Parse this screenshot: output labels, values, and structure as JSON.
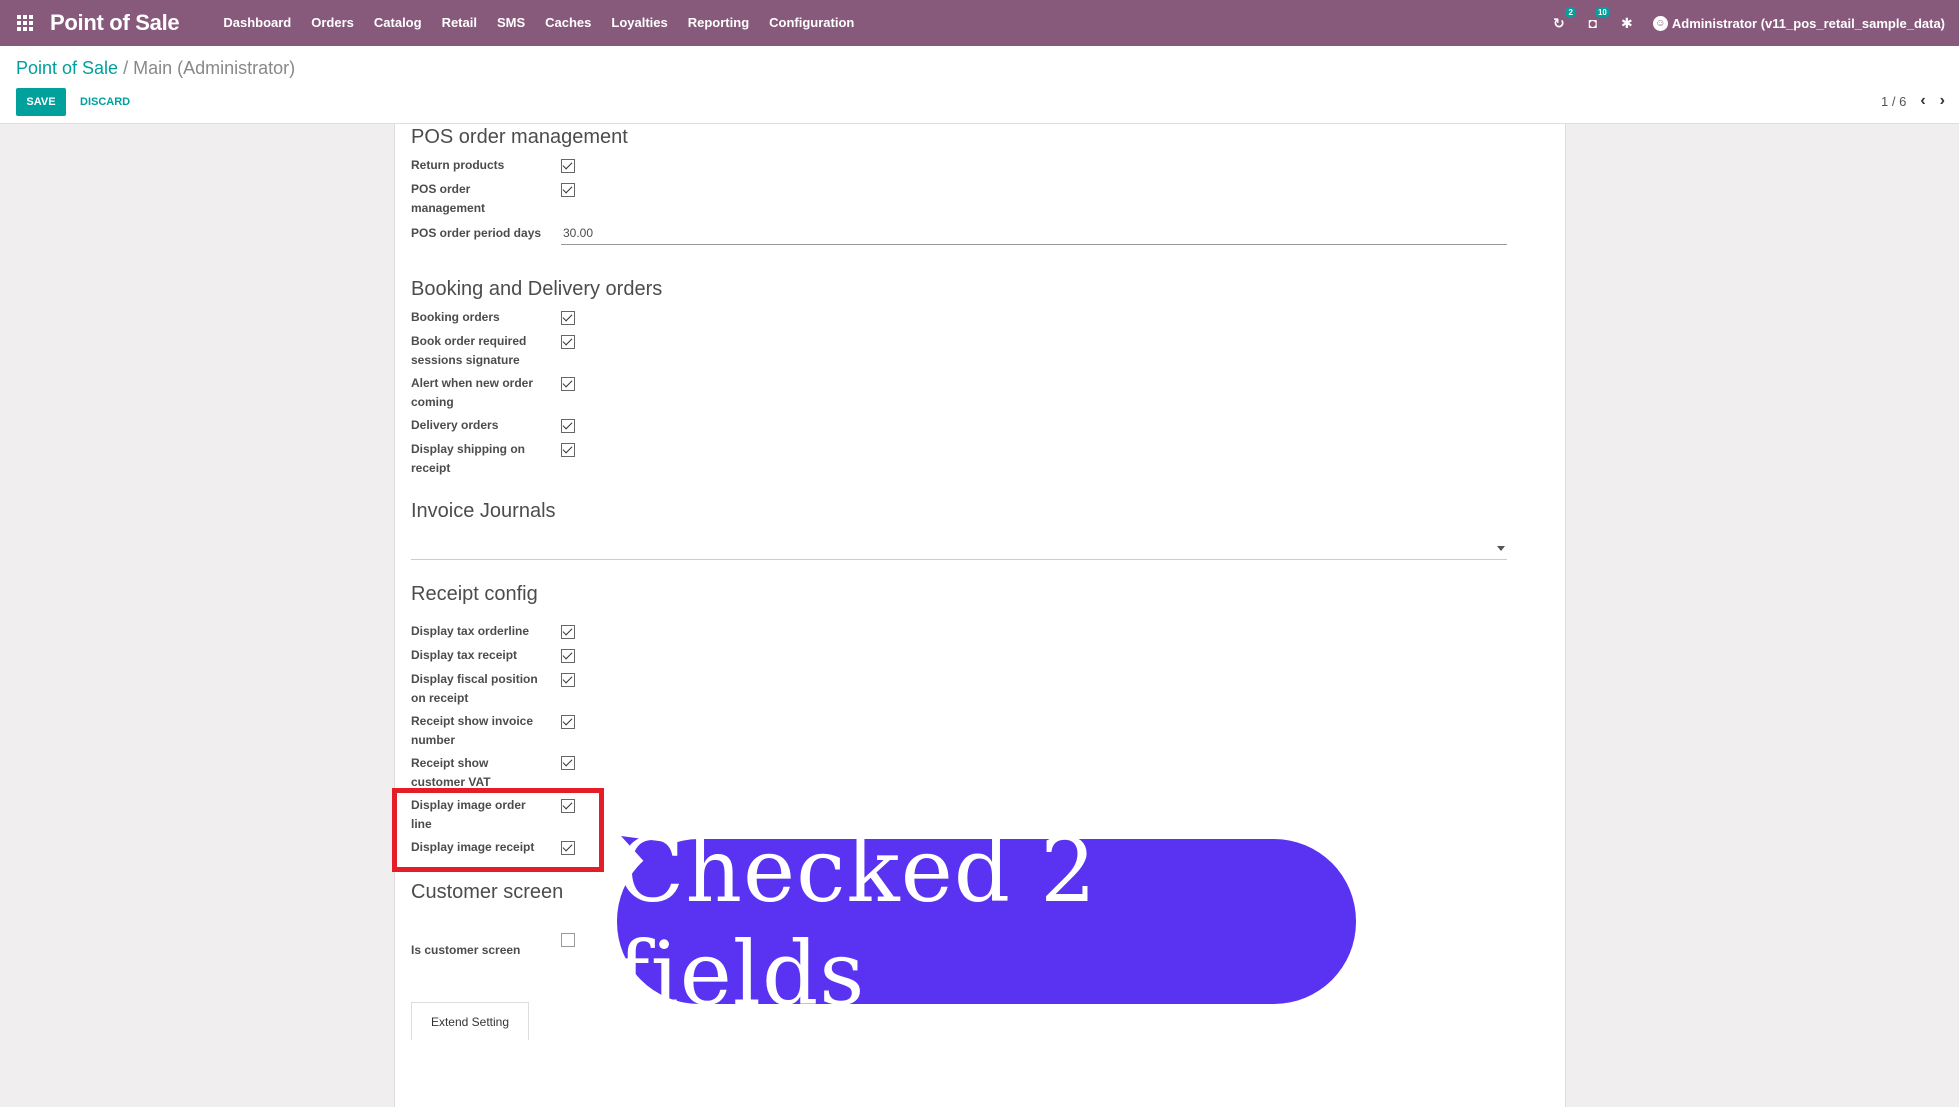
{
  "navbar": {
    "brand": "Point of Sale",
    "menu": [
      "Dashboard",
      "Orders",
      "Catalog",
      "Retail",
      "SMS",
      "Caches",
      "Loyalties",
      "Reporting",
      "Configuration"
    ],
    "activity_count": "2",
    "messages_count": "10",
    "user": "Administrator (v11_pos_retail_sample_data)"
  },
  "control": {
    "breadcrumb_parent": "Point of Sale",
    "breadcrumb_sep": "/",
    "breadcrumb_current": "Main (Administrator)",
    "save_label": "SAVE",
    "discard_label": "DISCARD",
    "pager": "1 / 6"
  },
  "sections": {
    "pos_order": {
      "title": "POS order management",
      "return_products": "Return products",
      "pos_order_management": "POS order management",
      "period_label": "POS order period days",
      "period_value": "30.00"
    },
    "booking": {
      "title": "Booking and Delivery orders",
      "booking_orders": "Booking orders",
      "book_signature": "Book order required sessions signature",
      "alert_new": "Alert when new order coming",
      "delivery_orders": "Delivery orders",
      "display_shipping": "Display shipping on receipt"
    },
    "invoice": {
      "title": "Invoice Journals"
    },
    "receipt": {
      "title": "Receipt config",
      "tax_orderline": "Display tax orderline",
      "tax_receipt": "Display tax receipt",
      "fiscal_position": "Display fiscal position on receipt",
      "invoice_number": "Receipt show invoice number",
      "customer_vat": "Receipt show customer VAT",
      "image_orderline": "Display image order line",
      "image_receipt": "Display image receipt"
    },
    "customer_screen": {
      "title": "Customer screen",
      "is_customer_screen": "Is customer screen"
    }
  },
  "extend_label": "Extend Setting",
  "annotation": {
    "text": "Checked 2 fields",
    "color": "#5a32f2",
    "highlight_color": "#e41e26"
  },
  "colors": {
    "navbar": "#875a7b",
    "accent": "#00a09d"
  }
}
